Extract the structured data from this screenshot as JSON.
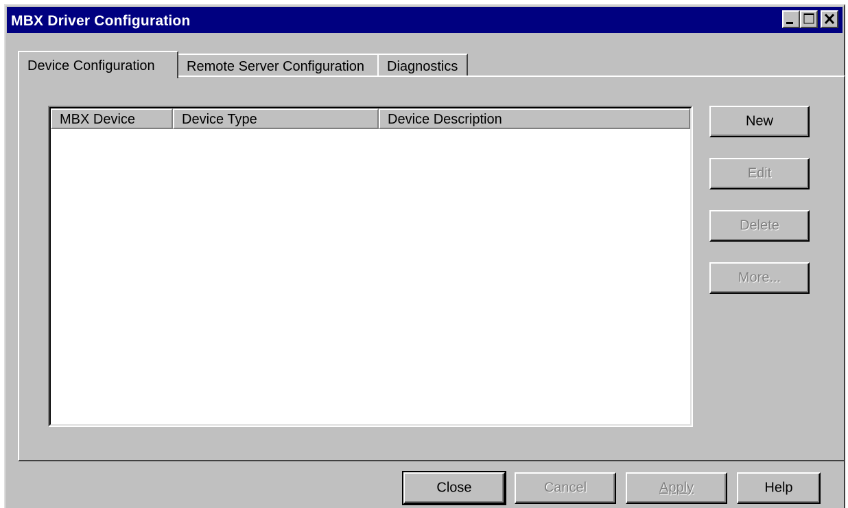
{
  "window": {
    "title": "MBX Driver Configuration",
    "title_bar_color": "#000080",
    "face_color": "#c0c0c0"
  },
  "titlebar_buttons": {
    "minimize_icon": "minimize-icon",
    "maximize_icon": "maximize-icon",
    "close_icon": "close-icon"
  },
  "tabs": [
    {
      "label": "Device Configuration",
      "active": true
    },
    {
      "label": "Remote Server Configuration",
      "active": false
    },
    {
      "label": "Diagnostics",
      "active": false
    }
  ],
  "device_list": {
    "columns": [
      "MBX Device",
      "Device Type",
      "Device Description"
    ],
    "rows": []
  },
  "side_buttons": {
    "new": {
      "label": "New",
      "enabled": true
    },
    "edit": {
      "label": "Edit",
      "enabled": false
    },
    "delete": {
      "label": "Delete",
      "enabled": false
    },
    "more": {
      "label": "More...",
      "enabled": false
    }
  },
  "bottom_buttons": {
    "close": {
      "label": "Close",
      "enabled": true,
      "default": true
    },
    "cancel": {
      "label": "Cancel",
      "enabled": false
    },
    "apply": {
      "label": "Apply",
      "enabled": false
    },
    "help": {
      "label": "Help",
      "enabled": true
    }
  }
}
